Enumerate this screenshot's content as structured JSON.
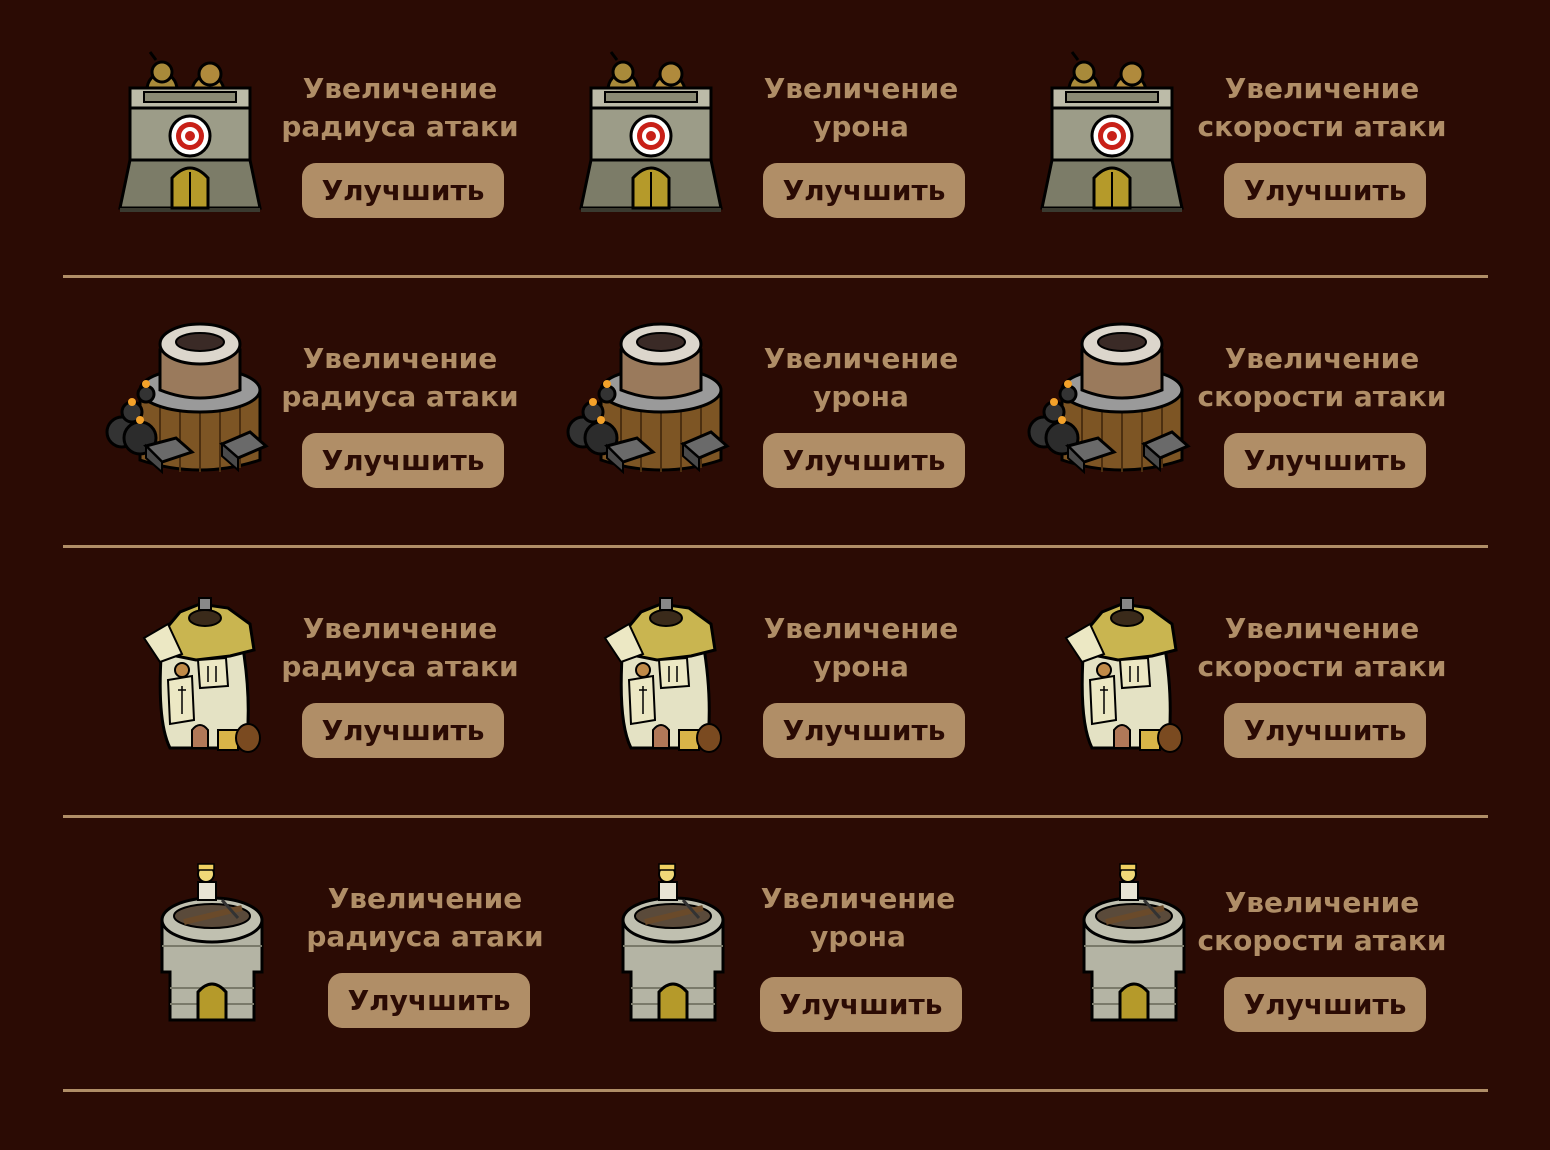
{
  "rows": [
    {
      "tower": "archer-bunker-tower",
      "cards": [
        {
          "line1": "Увеличение",
          "line2": "радиуса атаки",
          "button": "Улучшить"
        },
        {
          "line1": "Увеличение",
          "line2": "урона",
          "button": "Улучшить"
        },
        {
          "line1": "Увеличение",
          "line2": "скорости атаки",
          "button": "Улучшить"
        }
      ]
    },
    {
      "tower": "bomb-tower",
      "cards": [
        {
          "line1": "Увеличение",
          "line2": "радиуса атаки",
          "button": "Улучшить"
        },
        {
          "line1": "Увеличение",
          "line2": "урона",
          "button": "Улучшить"
        },
        {
          "line1": "Увеличение",
          "line2": "скорости атаки",
          "button": "Улучшить"
        }
      ]
    },
    {
      "tower": "mage-hut-tower",
      "cards": [
        {
          "line1": "Увеличение",
          "line2": "радиуса атаки",
          "button": "Улучшить"
        },
        {
          "line1": "Увеличение",
          "line2": "урона",
          "button": "Улучшить"
        },
        {
          "line1": "Увеличение",
          "line2": "скорости атаки",
          "button": "Улучшить"
        }
      ]
    },
    {
      "tower": "crossbow-tower",
      "cards": [
        {
          "line1": "Увеличение",
          "line2": "радиуса атаки",
          "button": "Улучшить"
        },
        {
          "line1": "Увеличение",
          "line2": "урона",
          "button": "Улучшить"
        },
        {
          "line1": "Увеличение",
          "line2": "скорости атаки",
          "button": "Улучшить"
        }
      ]
    }
  ],
  "colors": {
    "background": "#2b0b04",
    "accent": "#b08e67",
    "button_text": "#2b0b04"
  }
}
